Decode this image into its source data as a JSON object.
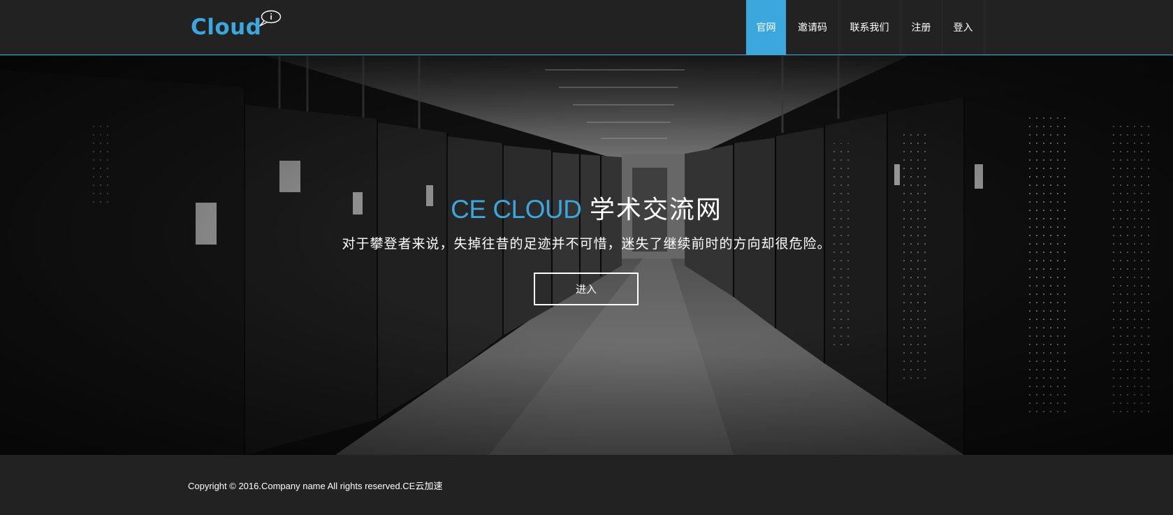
{
  "navbar": {
    "brand": "Cloud",
    "items": [
      {
        "label": "官网",
        "active": true
      },
      {
        "label": "邀请码",
        "active": false
      },
      {
        "label": "联系我们",
        "active": false
      },
      {
        "label": "注册",
        "active": false
      },
      {
        "label": "登入",
        "active": false
      }
    ]
  },
  "hero": {
    "title_accent": "CE CLOUD",
    "title_rest": "学术交流网",
    "subtitle": "对于攀登者来说，失掉往昔的足迹并不可惜，迷失了继续前时的方向却很危险。",
    "enter_label": "进入"
  },
  "footer": {
    "copyright": "Copyright © 2016.Company name All rights reserved.CE云加速"
  },
  "colors": {
    "accent": "#3ba7dc",
    "nav_bg": "#222222",
    "footer_bg": "#222222"
  },
  "icons": {
    "brand_bubble": "info-speech-bubble-icon"
  }
}
